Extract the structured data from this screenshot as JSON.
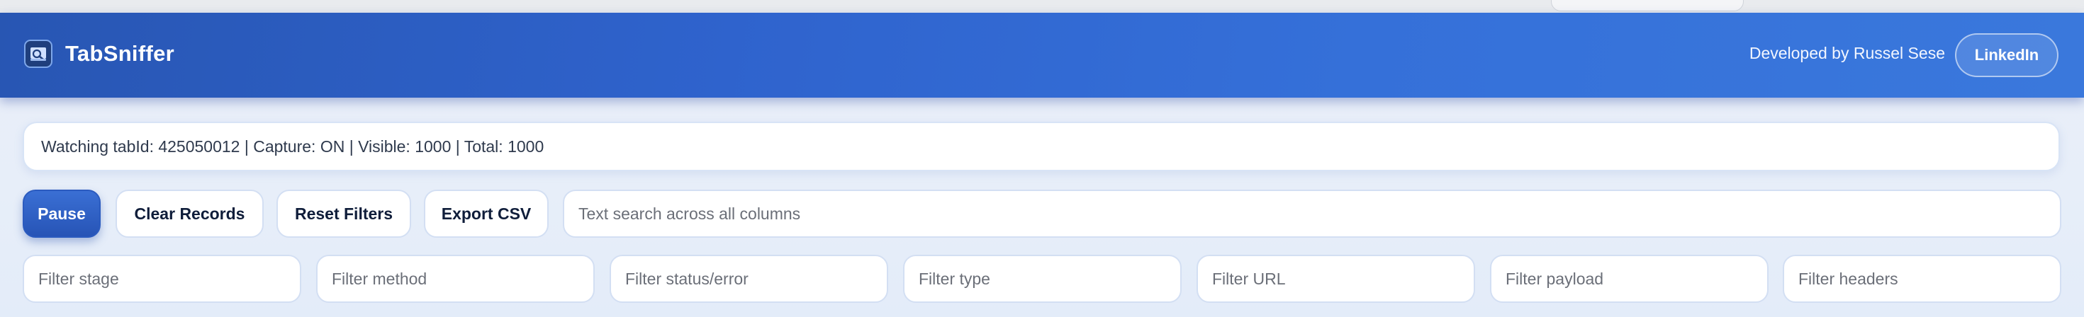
{
  "app": {
    "title": "TabSniffer",
    "developer_text": "Developed by Russel Sese",
    "linkedin_label": "LinkedIn"
  },
  "status": {
    "text": "Watching tabId: 425050012 | Capture: ON | Visible: 1000 | Total: 1000"
  },
  "toolbar": {
    "pause_label": "Pause",
    "clear_label": "Clear Records",
    "reset_label": "Reset Filters",
    "export_label": "Export CSV",
    "search_placeholder": "Text search across all columns",
    "search_value": ""
  },
  "filters": {
    "stage_placeholder": "Filter stage",
    "method_placeholder": "Filter method",
    "status_placeholder": "Filter status/error",
    "type_placeholder": "Filter type",
    "url_placeholder": "Filter URL",
    "payload_placeholder": "Filter payload",
    "headers_placeholder": "Filter headers"
  },
  "icons": {
    "logo": "spy-glass-logo-icon"
  },
  "colors": {
    "header_start": "#2856b3",
    "header_end": "#3a78dc",
    "primary_button": "#2b5bbf"
  }
}
